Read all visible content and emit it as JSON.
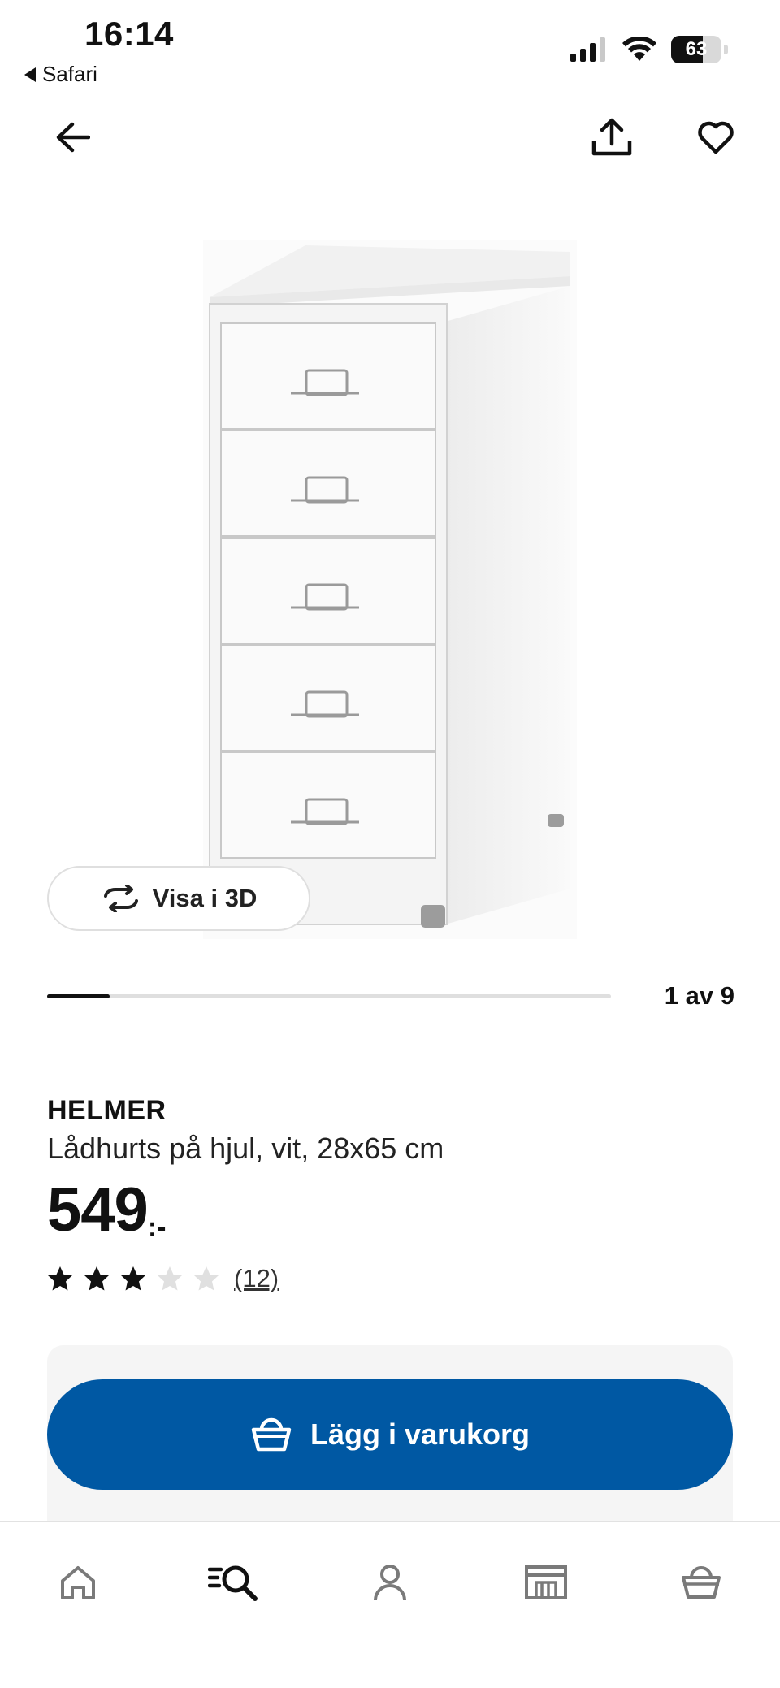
{
  "status_bar": {
    "time": "16:14",
    "back_app": "Safari",
    "battery_level": "63",
    "battery_fraction": 0.63
  },
  "nav": {
    "back_icon": "arrow-left-icon",
    "share_icon": "share-icon",
    "favorite_icon": "heart-icon"
  },
  "gallery": {
    "view_3d_label": "Visa i 3D",
    "view_3d_icon": "rotate-icon",
    "counter": "1 av 9",
    "progress_fraction": 0.111
  },
  "product": {
    "brand": "HELMER",
    "description": "Lådhurts på hjul, vit, 28x65 cm",
    "price": "549",
    "price_suffix": ":-",
    "rating_stars": 3,
    "rating_max": 5,
    "review_count": "(12)"
  },
  "cart": {
    "button_label": "Lägg i varukorg",
    "button_icon": "basket-icon"
  },
  "tabbar": {
    "items": [
      {
        "name": "home-icon"
      },
      {
        "name": "search-icon"
      },
      {
        "name": "profile-icon"
      },
      {
        "name": "store-icon"
      },
      {
        "name": "basket-icon"
      }
    ]
  },
  "colors": {
    "primary_blue": "#0058a3",
    "panel_bg": "#f5f5f5",
    "text": "#111111",
    "star_empty": "#e0e0e0"
  }
}
